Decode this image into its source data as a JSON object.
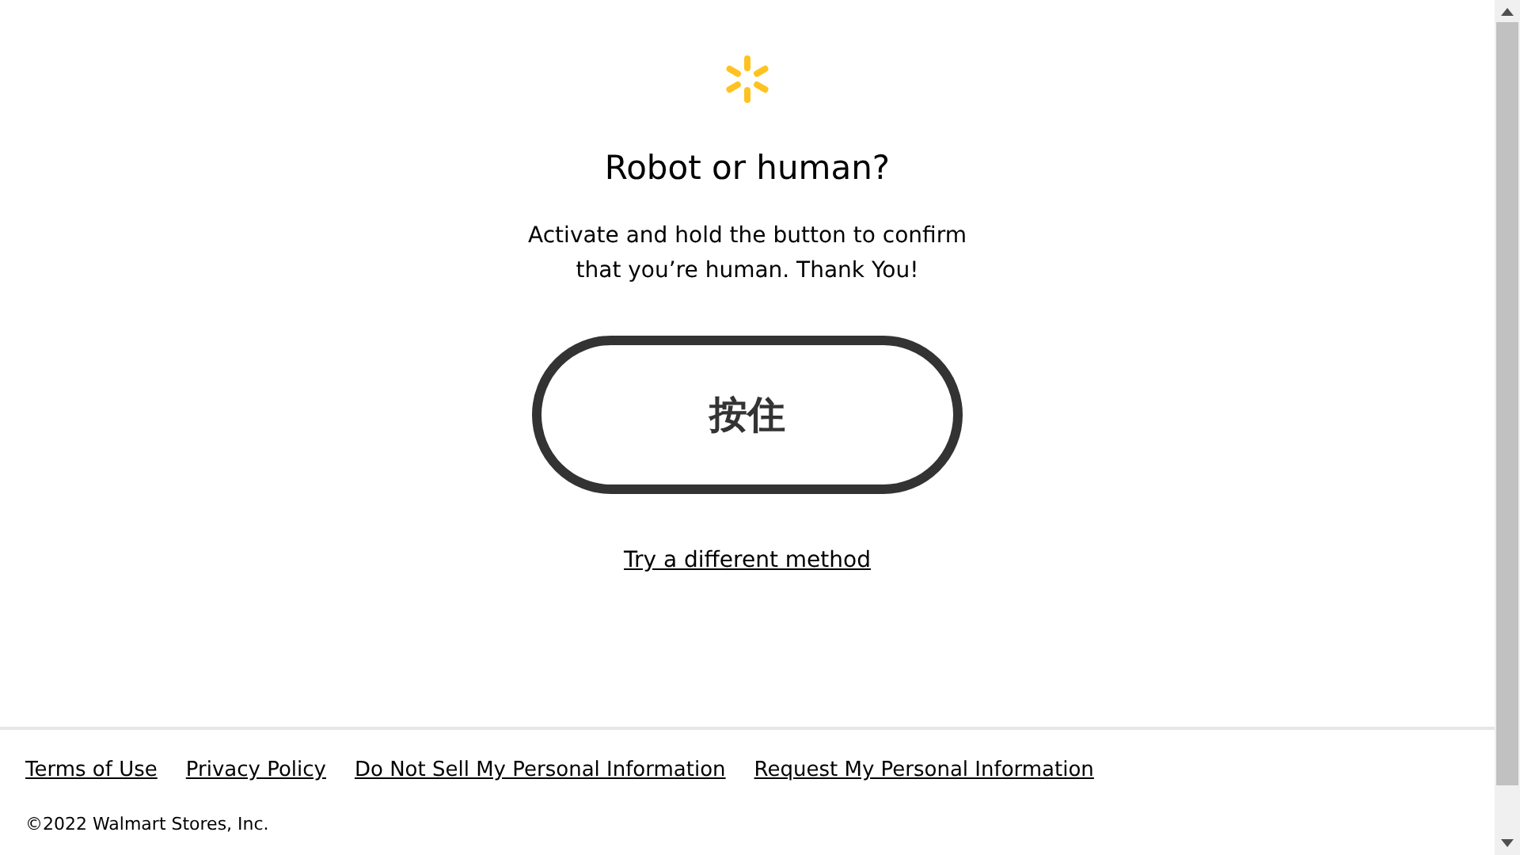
{
  "title": "Robot or human?",
  "message": "Activate and hold the button to confirm that you’re human. Thank You!",
  "hold_button": {
    "label": "按住"
  },
  "alternative_link": "Try a different method",
  "footer": {
    "links": [
      "Terms of Use",
      "Privacy Policy",
      "Do Not Sell My Personal Information",
      "Request My Personal Information"
    ],
    "copyright": "©2022 Walmart Stores, Inc."
  }
}
